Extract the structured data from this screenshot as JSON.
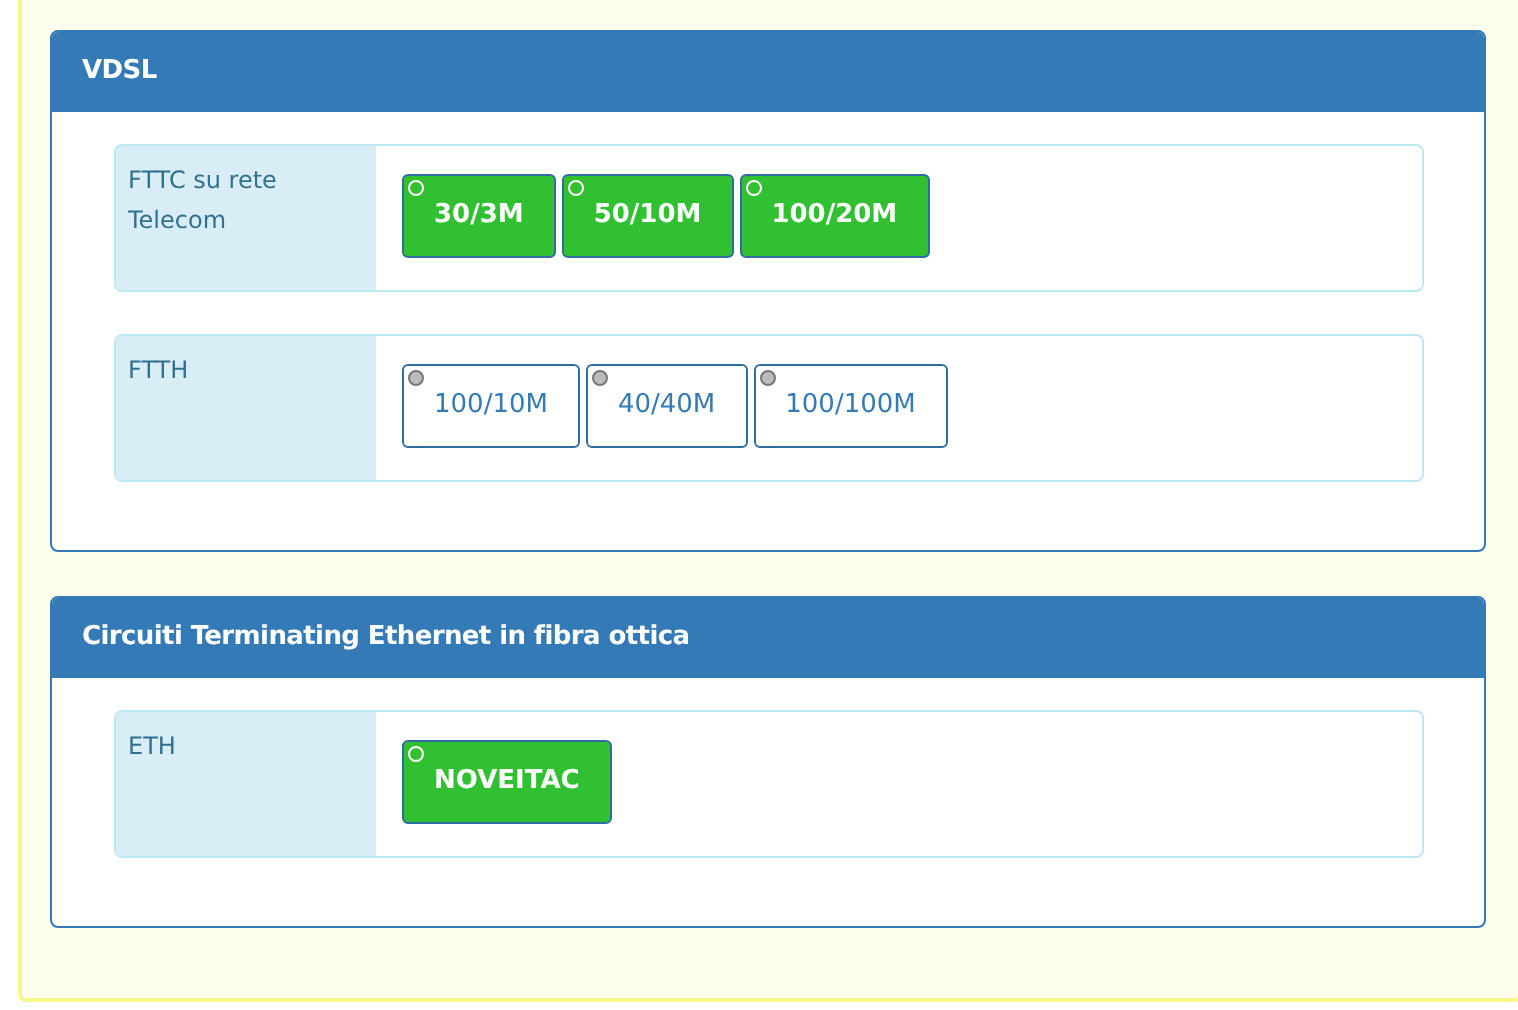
{
  "panels": [
    {
      "title": "VDSL",
      "rows": [
        {
          "label": "FTTC su rete Telecom",
          "options": [
            {
              "label": "30/3M",
              "selected": true
            },
            {
              "label": "50/10M",
              "selected": true
            },
            {
              "label": "100/20M",
              "selected": true
            }
          ]
        },
        {
          "label": "FTTH",
          "options": [
            {
              "label": "100/10M",
              "selected": false
            },
            {
              "label": "40/40M",
              "selected": false
            },
            {
              "label": "100/100M",
              "selected": false
            }
          ]
        }
      ]
    },
    {
      "title": "Circuiti Terminating Ethernet in fibra ottica",
      "rows": [
        {
          "label": "ETH",
          "options": [
            {
              "label": "NOVEITAC",
              "selected": true
            }
          ]
        }
      ]
    }
  ]
}
